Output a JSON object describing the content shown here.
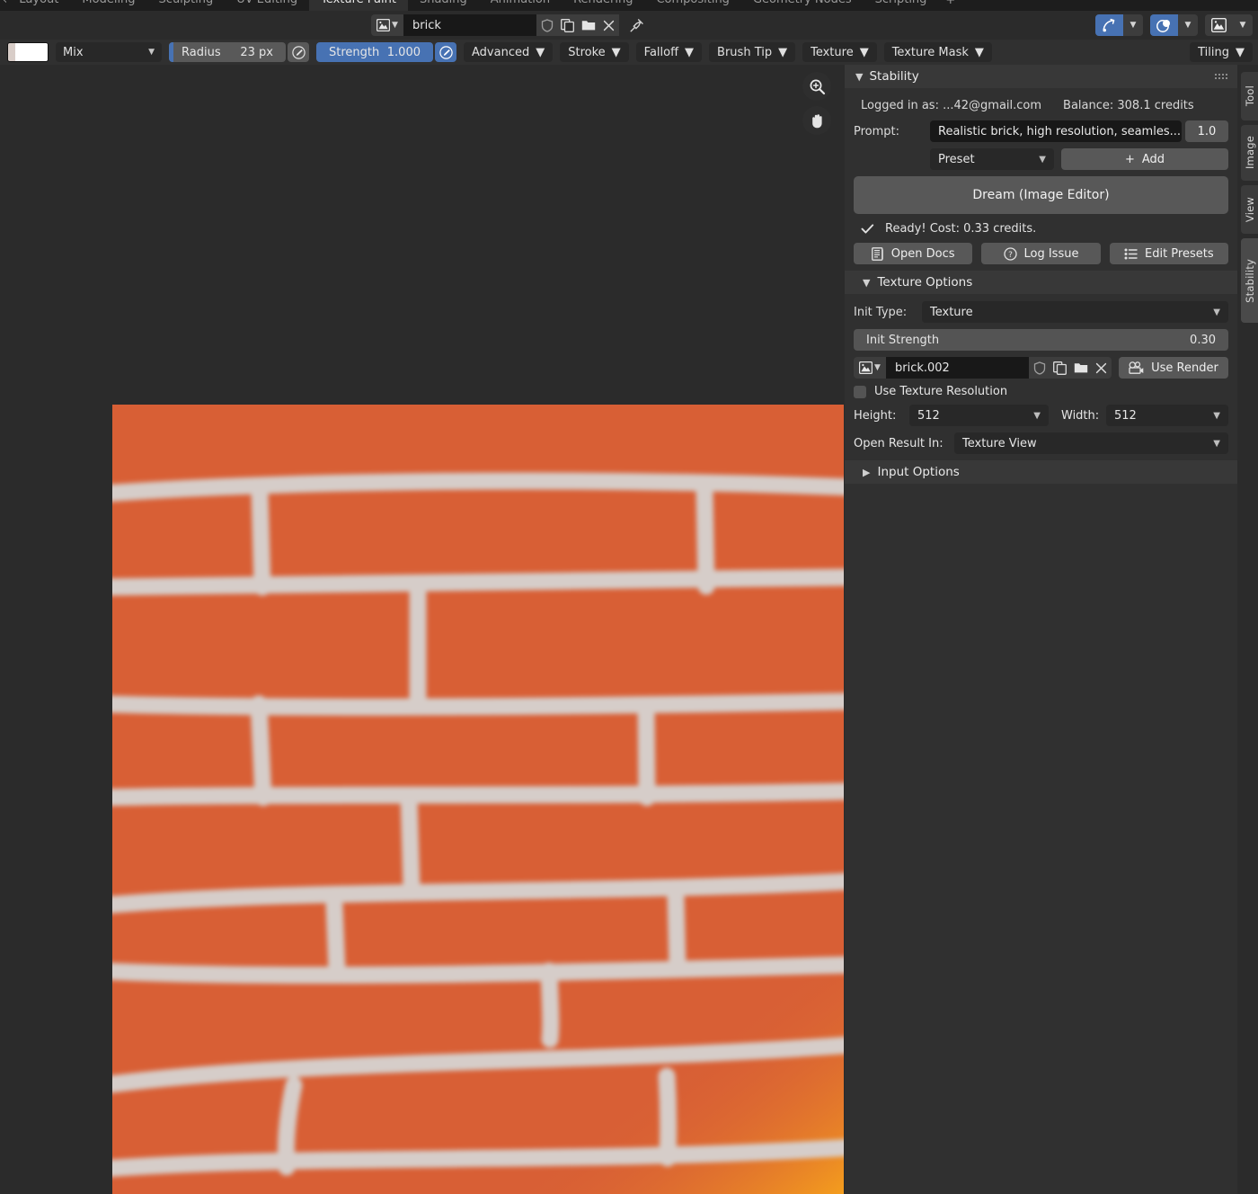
{
  "workspace_tabs": [
    {
      "label": "Layout",
      "active": false
    },
    {
      "label": "Modeling",
      "active": false
    },
    {
      "label": "Sculpting",
      "active": false
    },
    {
      "label": "UV Editing",
      "active": false
    },
    {
      "label": "Texture Paint",
      "active": true
    },
    {
      "label": "Shading",
      "active": false
    },
    {
      "label": "Animation",
      "active": false
    },
    {
      "label": "Rendering",
      "active": false
    },
    {
      "label": "Compositing",
      "active": false
    },
    {
      "label": "Geometry Nodes",
      "active": false
    },
    {
      "label": "Scripting",
      "active": false
    }
  ],
  "workspace_add_label": "+",
  "editor_header": {
    "datablock_name": "brick",
    "icons": [
      "image-datablock-icon",
      "shield-fake-user-icon",
      "new-copy-icon",
      "open-folder-icon",
      "unlink-x-icon",
      "pin-icon"
    ],
    "right_toggles": [
      "overlays-arrow-icon",
      "mask-overlay-icon",
      "image-display-icon"
    ]
  },
  "tool_settings": {
    "blend_mode": "Mix",
    "radius_label": "Radius",
    "radius_value": "23 px",
    "strength_label": "Strength",
    "strength_value": "1.000",
    "popovers": [
      "Advanced",
      "Stroke",
      "Falloff",
      "Brush Tip",
      "Texture",
      "Texture Mask"
    ],
    "tiling_label": "Tiling",
    "color_primary": "#ffffff",
    "color_secondary": "#d8cdc8",
    "accent_blue": "#4772b3"
  },
  "viewport": {
    "gizmos": [
      "zoom-in-icon",
      "pan-hand-icon"
    ],
    "image_colors": {
      "brick": "#d85f35",
      "mortar": "#d6cdc9",
      "glow": "#f39a1e"
    }
  },
  "sidebar": {
    "panel_title": "Stability",
    "account": {
      "login_text": "Logged in as: ...42@gmail.com",
      "balance_text": "Balance: 308.1 credits"
    },
    "prompt": {
      "label": "Prompt:",
      "value": "Realistic brick, high resolution, seamles...",
      "weight": "1.0"
    },
    "preset": {
      "selected": "Preset",
      "add_label": "Add",
      "add_plus": "+"
    },
    "dream_button": "Dream (Image Editor)",
    "status_text": "Ready! Cost: 0.33 credits.",
    "actions": [
      {
        "label": "Open Docs",
        "icon": "docs-icon"
      },
      {
        "label": "Log Issue",
        "icon": "question-circle-icon"
      },
      {
        "label": "Edit Presets",
        "icon": "list-icon"
      }
    ],
    "texture_options": {
      "header": "Texture Options",
      "init_type_label": "Init Type:",
      "init_type_value": "Texture",
      "init_strength_label": "Init Strength",
      "init_strength_value": "0.30",
      "texture_datablock": "brick.002",
      "use_render_label": "Use Render",
      "use_texture_resolution_label": "Use Texture Resolution",
      "use_texture_resolution_checked": false,
      "height_label": "Height:",
      "height_value": "512",
      "width_label": "Width:",
      "width_value": "512",
      "open_result_label": "Open Result In:",
      "open_result_value": "Texture View"
    },
    "input_options_header": "Input Options"
  },
  "vertical_tabs": [
    {
      "label": "Tool",
      "active": false
    },
    {
      "label": "Image",
      "active": false
    },
    {
      "label": "View",
      "active": false
    },
    {
      "label": "Stability",
      "active": true
    }
  ]
}
